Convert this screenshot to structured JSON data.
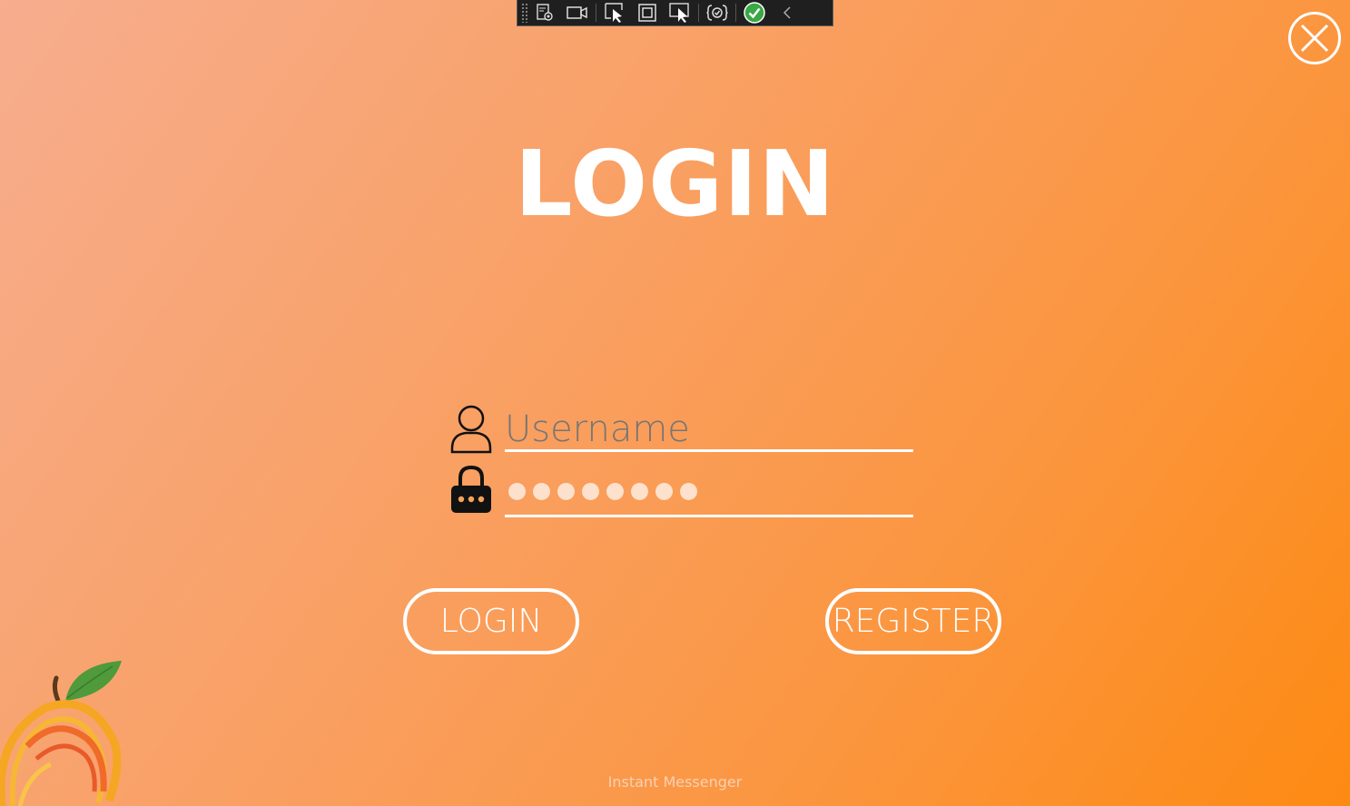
{
  "window": {
    "close_icon": "close-circle-icon"
  },
  "devtoolbar": {
    "icons": [
      "live-visual-tree-icon",
      "video-camera-icon",
      "select-element-icon",
      "display-layout-adorners-icon",
      "track-focus-icon",
      "binding-failures-icon",
      "hot-reload-check-icon",
      "collapse-chevron-icon"
    ]
  },
  "title": "LOGIN",
  "form": {
    "username_placeholder": "Username",
    "username_value": "",
    "password_masked_count": 8,
    "user_icon": "user-icon",
    "lock_icon": "lock-icon"
  },
  "buttons": {
    "login_label": "LOGIN",
    "register_label": "REGISTER"
  },
  "footer": "Instant Messenger",
  "colors": {
    "gradient_start": "#f7ad8e",
    "gradient_end": "#fd8a12",
    "text": "#ffffff",
    "placeholder": "#fde0c8"
  }
}
